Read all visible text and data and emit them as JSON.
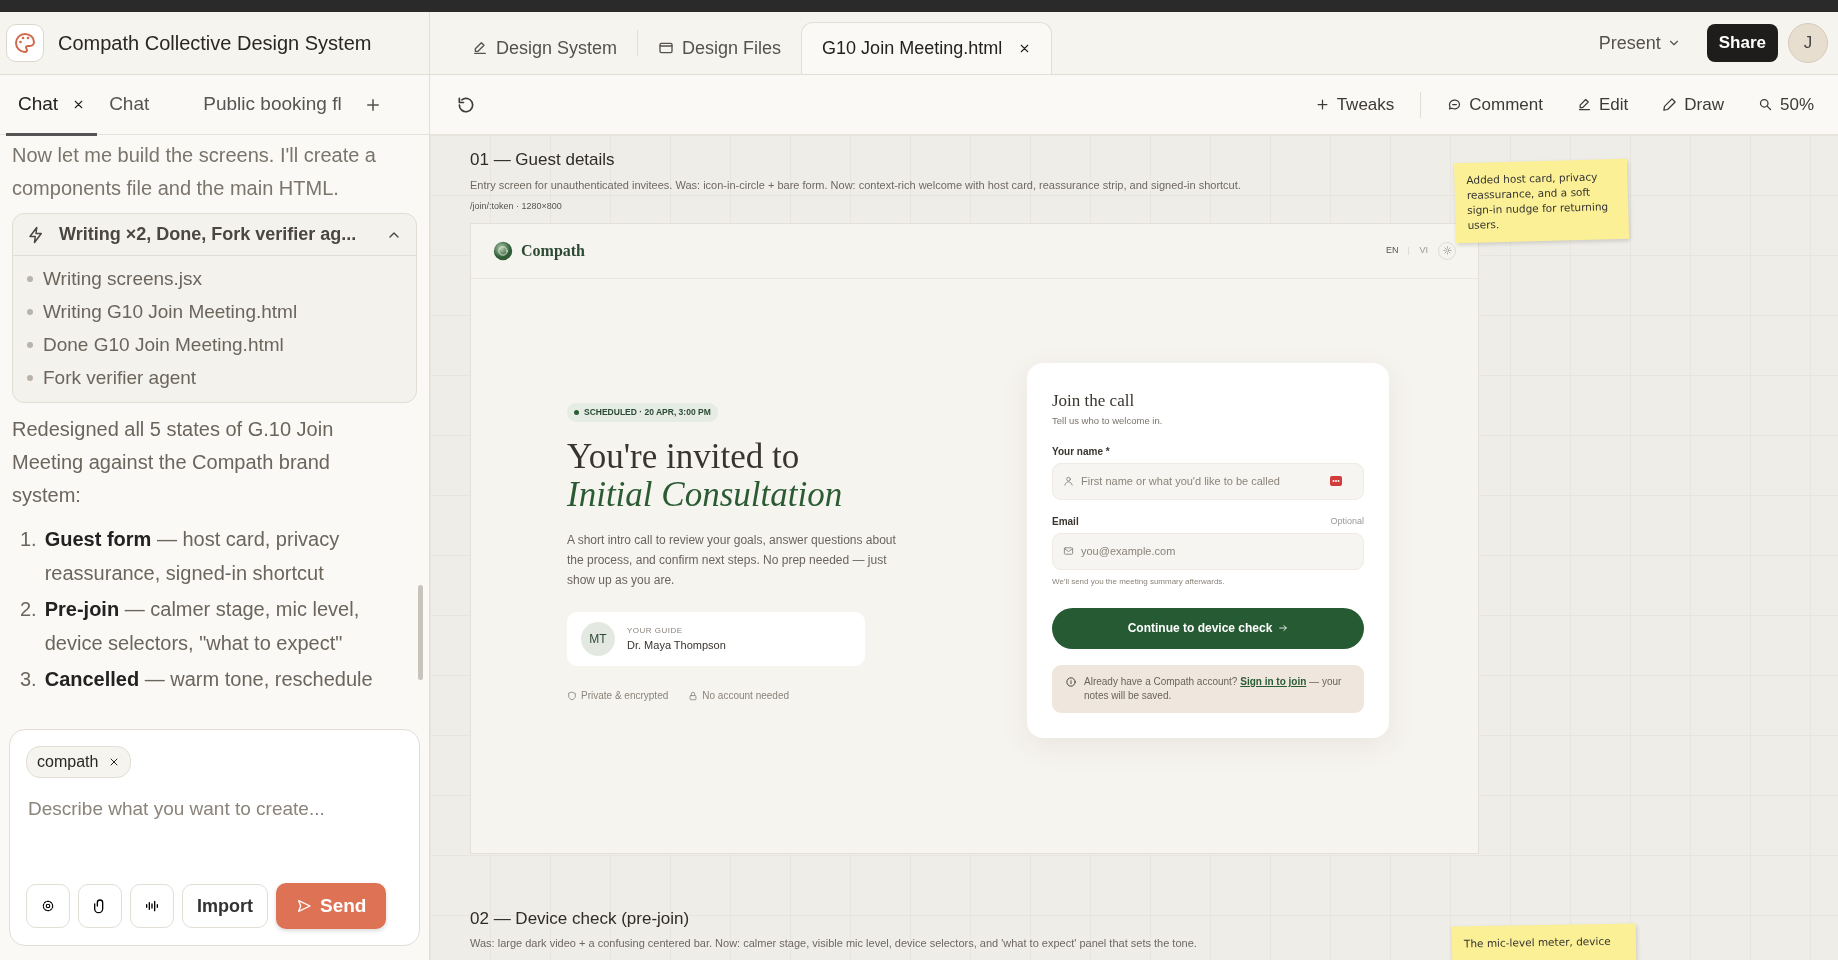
{
  "app": {
    "title": "Compath Collective Design System"
  },
  "file_tabs": [
    {
      "label": "Design System",
      "kind": "design",
      "selected": false,
      "closable": false
    },
    {
      "label": "Design Files",
      "kind": "files",
      "selected": false,
      "closable": false
    },
    {
      "label": "G10 Join Meeting.html",
      "selected": true,
      "closable": true
    }
  ],
  "header": {
    "present": "Present",
    "share": "Share",
    "avatar": "J"
  },
  "chat_tabs": [
    {
      "label": "Chat",
      "selected": true,
      "closable": true
    },
    {
      "label": "Chat",
      "selected": false,
      "closable": false
    },
    {
      "label": "Public booking fl",
      "selected": false,
      "closable": false
    }
  ],
  "toolbar": [
    {
      "label": "Tweaks",
      "kind": "plus"
    },
    {
      "label": "Comment",
      "kind": "comment"
    },
    {
      "label": "Edit",
      "kind": "edit"
    },
    {
      "label": "Draw",
      "kind": "draw"
    },
    {
      "label": "50%",
      "kind": "zoom"
    }
  ],
  "chat": {
    "intro": "Now let me build the screens. I'll create a components file and the main HTML.",
    "tool_group": {
      "title": "Writing ×2, Done, Fork verifier ag...",
      "expanded": true,
      "items": [
        "Writing screens.jsx",
        "Writing G10 Join Meeting.html",
        "Done G10 Join Meeting.html",
        "Fork verifier agent"
      ]
    },
    "summary": "Redesigned all 5 states of G.10 Join Meeting against the Compath brand system:",
    "list": [
      {
        "number": "1.",
        "text": "**Guest form** — host card, privacy reassurance, signed-in shortcut"
      },
      {
        "number": "2.",
        "text": "**Pre-join** — calmer stage, mic level, device selectors, \"what to expect\""
      },
      {
        "number": "3.",
        "text": "**Cancelled** — warm tone, reschedule"
      }
    ]
  },
  "composer": {
    "tag": "compath",
    "placeholder": "Describe what you want to create...",
    "import": "Import",
    "send": "Send"
  },
  "sections": [
    {
      "title": "01 — Guest details",
      "description": "Entry screen for unauthenticated invitees. Was: icon-in-circle + bare form. Now: context-rich welcome with host card, reassurance strip, and signed-in shortcut.",
      "meta": "/join/:token · 1280×800",
      "note": "Added host card, privacy reassurance, and a soft sign-in nudge for returning users."
    },
    {
      "title": "02 — Device check (pre-join)",
      "description": "Was: large dark video + a confusing centered bar. Now: calmer stage, visible mic level, device selectors, and 'what to expect' panel that sets the tone.",
      "note": "The mic-level meter, device"
    }
  ],
  "mockup": {
    "brand": "Compath",
    "languages": [
      {
        "label": "EN",
        "selected": true
      },
      {
        "label": "VI",
        "selected": false
      }
    ],
    "badge": "SCHEDULED · 20 APR, 3:00 PM",
    "heading": "You're invited to",
    "heading_accent": "Initial Consultation",
    "description": "A short intro call to review your goals, answer questions about the process, and confirm next steps. No prep needed — just show up as you are.",
    "guide": {
      "initials": "MT",
      "label": "YOUR GUIDE",
      "name": "Dr. Maya Thompson"
    },
    "trust": [
      {
        "kind": "shield",
        "text": "Private & encrypted"
      },
      {
        "kind": "lock",
        "text": "No account needed"
      }
    ],
    "form": {
      "title": "Join the call",
      "subtitle": "Tell us who to welcome in.",
      "fields": [
        {
          "kind": "person",
          "label": "Your name *",
          "placeholder": "First name or what you'd like to be called",
          "autofill": true
        },
        {
          "kind": "mail",
          "label": "Email",
          "aside": "Optional",
          "placeholder": "you@example.com",
          "help": "We'll send you the meeting summary afterwards.",
          "autofill": false
        }
      ],
      "button": "Continue to device check",
      "notice": {
        "before": "Already have a Compath account?",
        "link": "Sign in to join",
        "after": "— your notes will be saved."
      }
    }
  }
}
